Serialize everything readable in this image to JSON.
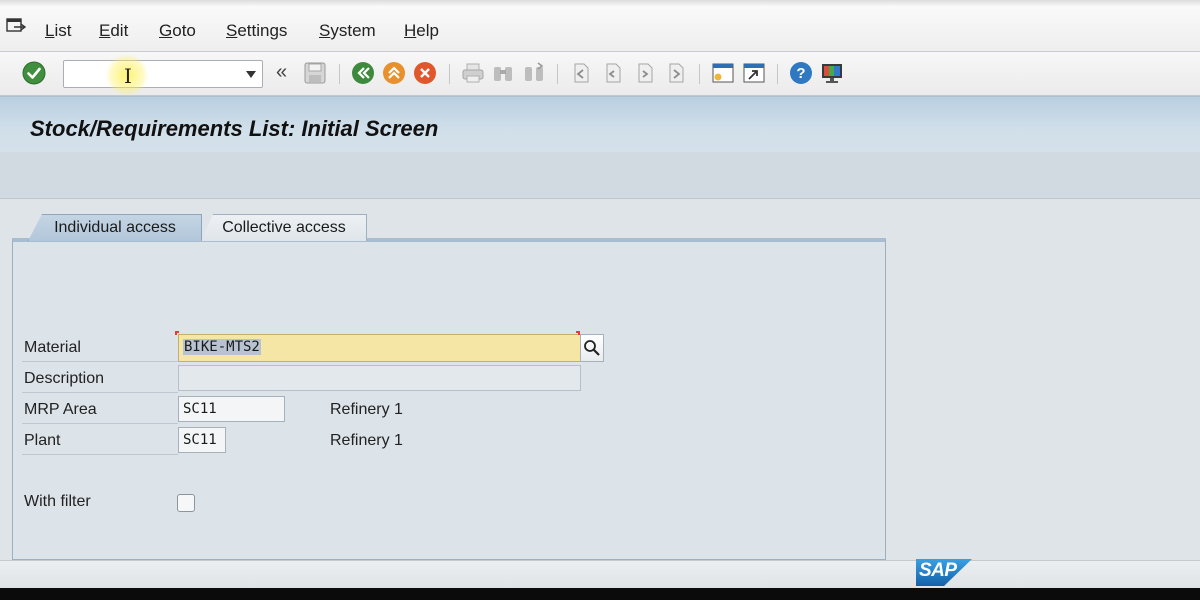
{
  "menu": {
    "items": [
      {
        "mnemonic": "L",
        "rest": "ist"
      },
      {
        "mnemonic": "E",
        "rest": "dit"
      },
      {
        "mnemonic": "G",
        "rest": "oto"
      },
      {
        "mnemonic": "S",
        "rest": "ettings"
      },
      {
        "mnemonic": "S",
        "rest": "ystem"
      },
      {
        "mnemonic": "H",
        "rest": "elp"
      }
    ]
  },
  "toolbar": {
    "command_value": "",
    "nav_chevrons": "«",
    "icons": [
      "enter-icon",
      "save-icon",
      "back-icon",
      "exit-icon",
      "cancel-icon",
      "print-icon",
      "find-icon",
      "find-next-icon",
      "first-page-icon",
      "previous-page-icon",
      "next-page-icon",
      "last-page-icon",
      "create-session-icon",
      "create-shortcut-icon",
      "help-icon",
      "customize-layout-icon"
    ]
  },
  "page": {
    "title": "Stock/Requirements List: Initial Screen"
  },
  "tabs": [
    {
      "label": "Individual access",
      "active": true
    },
    {
      "label": "Collective access",
      "active": false
    }
  ],
  "form": {
    "material_label": "Material",
    "material_value": "BIKE-MTS2",
    "description_label": "Description",
    "description_value": "",
    "mrp_area_label": "MRP Area",
    "mrp_area_value": "SC11",
    "mrp_area_text": "Refinery 1",
    "plant_label": "Plant",
    "plant_value": "SC11",
    "plant_text": "Refinery 1",
    "with_filter_label": "With filter",
    "with_filter_checked": false
  },
  "branding": {
    "logo_text": "SAP",
    "accent": "#1b75bb"
  }
}
